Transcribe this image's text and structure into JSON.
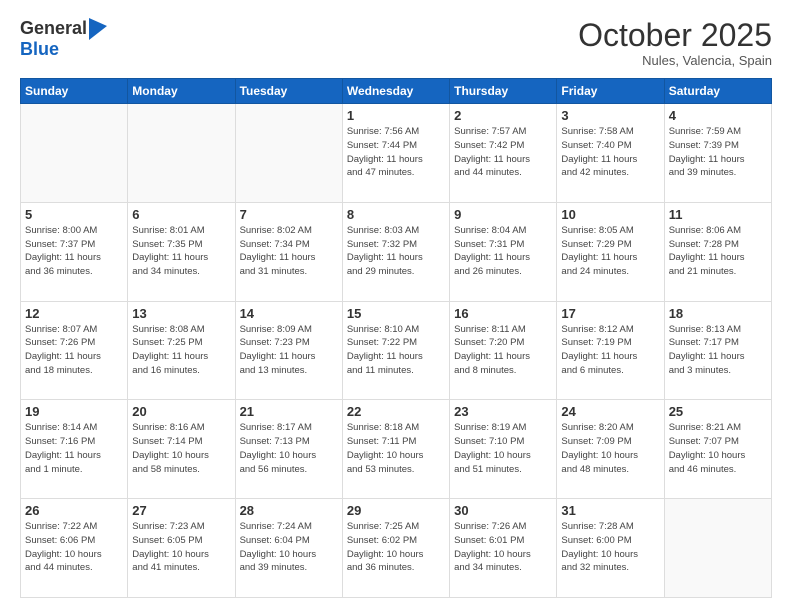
{
  "header": {
    "logo_general": "General",
    "logo_blue": "Blue",
    "month": "October 2025",
    "location": "Nules, Valencia, Spain"
  },
  "days_of_week": [
    "Sunday",
    "Monday",
    "Tuesday",
    "Wednesday",
    "Thursday",
    "Friday",
    "Saturday"
  ],
  "weeks": [
    [
      {
        "day": "",
        "info": ""
      },
      {
        "day": "",
        "info": ""
      },
      {
        "day": "",
        "info": ""
      },
      {
        "day": "1",
        "info": "Sunrise: 7:56 AM\nSunset: 7:44 PM\nDaylight: 11 hours\nand 47 minutes."
      },
      {
        "day": "2",
        "info": "Sunrise: 7:57 AM\nSunset: 7:42 PM\nDaylight: 11 hours\nand 44 minutes."
      },
      {
        "day": "3",
        "info": "Sunrise: 7:58 AM\nSunset: 7:40 PM\nDaylight: 11 hours\nand 42 minutes."
      },
      {
        "day": "4",
        "info": "Sunrise: 7:59 AM\nSunset: 7:39 PM\nDaylight: 11 hours\nand 39 minutes."
      }
    ],
    [
      {
        "day": "5",
        "info": "Sunrise: 8:00 AM\nSunset: 7:37 PM\nDaylight: 11 hours\nand 36 minutes."
      },
      {
        "day": "6",
        "info": "Sunrise: 8:01 AM\nSunset: 7:35 PM\nDaylight: 11 hours\nand 34 minutes."
      },
      {
        "day": "7",
        "info": "Sunrise: 8:02 AM\nSunset: 7:34 PM\nDaylight: 11 hours\nand 31 minutes."
      },
      {
        "day": "8",
        "info": "Sunrise: 8:03 AM\nSunset: 7:32 PM\nDaylight: 11 hours\nand 29 minutes."
      },
      {
        "day": "9",
        "info": "Sunrise: 8:04 AM\nSunset: 7:31 PM\nDaylight: 11 hours\nand 26 minutes."
      },
      {
        "day": "10",
        "info": "Sunrise: 8:05 AM\nSunset: 7:29 PM\nDaylight: 11 hours\nand 24 minutes."
      },
      {
        "day": "11",
        "info": "Sunrise: 8:06 AM\nSunset: 7:28 PM\nDaylight: 11 hours\nand 21 minutes."
      }
    ],
    [
      {
        "day": "12",
        "info": "Sunrise: 8:07 AM\nSunset: 7:26 PM\nDaylight: 11 hours\nand 18 minutes."
      },
      {
        "day": "13",
        "info": "Sunrise: 8:08 AM\nSunset: 7:25 PM\nDaylight: 11 hours\nand 16 minutes."
      },
      {
        "day": "14",
        "info": "Sunrise: 8:09 AM\nSunset: 7:23 PM\nDaylight: 11 hours\nand 13 minutes."
      },
      {
        "day": "15",
        "info": "Sunrise: 8:10 AM\nSunset: 7:22 PM\nDaylight: 11 hours\nand 11 minutes."
      },
      {
        "day": "16",
        "info": "Sunrise: 8:11 AM\nSunset: 7:20 PM\nDaylight: 11 hours\nand 8 minutes."
      },
      {
        "day": "17",
        "info": "Sunrise: 8:12 AM\nSunset: 7:19 PM\nDaylight: 11 hours\nand 6 minutes."
      },
      {
        "day": "18",
        "info": "Sunrise: 8:13 AM\nSunset: 7:17 PM\nDaylight: 11 hours\nand 3 minutes."
      }
    ],
    [
      {
        "day": "19",
        "info": "Sunrise: 8:14 AM\nSunset: 7:16 PM\nDaylight: 11 hours\nand 1 minute."
      },
      {
        "day": "20",
        "info": "Sunrise: 8:16 AM\nSunset: 7:14 PM\nDaylight: 10 hours\nand 58 minutes."
      },
      {
        "day": "21",
        "info": "Sunrise: 8:17 AM\nSunset: 7:13 PM\nDaylight: 10 hours\nand 56 minutes."
      },
      {
        "day": "22",
        "info": "Sunrise: 8:18 AM\nSunset: 7:11 PM\nDaylight: 10 hours\nand 53 minutes."
      },
      {
        "day": "23",
        "info": "Sunrise: 8:19 AM\nSunset: 7:10 PM\nDaylight: 10 hours\nand 51 minutes."
      },
      {
        "day": "24",
        "info": "Sunrise: 8:20 AM\nSunset: 7:09 PM\nDaylight: 10 hours\nand 48 minutes."
      },
      {
        "day": "25",
        "info": "Sunrise: 8:21 AM\nSunset: 7:07 PM\nDaylight: 10 hours\nand 46 minutes."
      }
    ],
    [
      {
        "day": "26",
        "info": "Sunrise: 7:22 AM\nSunset: 6:06 PM\nDaylight: 10 hours\nand 44 minutes."
      },
      {
        "day": "27",
        "info": "Sunrise: 7:23 AM\nSunset: 6:05 PM\nDaylight: 10 hours\nand 41 minutes."
      },
      {
        "day": "28",
        "info": "Sunrise: 7:24 AM\nSunset: 6:04 PM\nDaylight: 10 hours\nand 39 minutes."
      },
      {
        "day": "29",
        "info": "Sunrise: 7:25 AM\nSunset: 6:02 PM\nDaylight: 10 hours\nand 36 minutes."
      },
      {
        "day": "30",
        "info": "Sunrise: 7:26 AM\nSunset: 6:01 PM\nDaylight: 10 hours\nand 34 minutes."
      },
      {
        "day": "31",
        "info": "Sunrise: 7:28 AM\nSunset: 6:00 PM\nDaylight: 10 hours\nand 32 minutes."
      },
      {
        "day": "",
        "info": ""
      }
    ]
  ]
}
